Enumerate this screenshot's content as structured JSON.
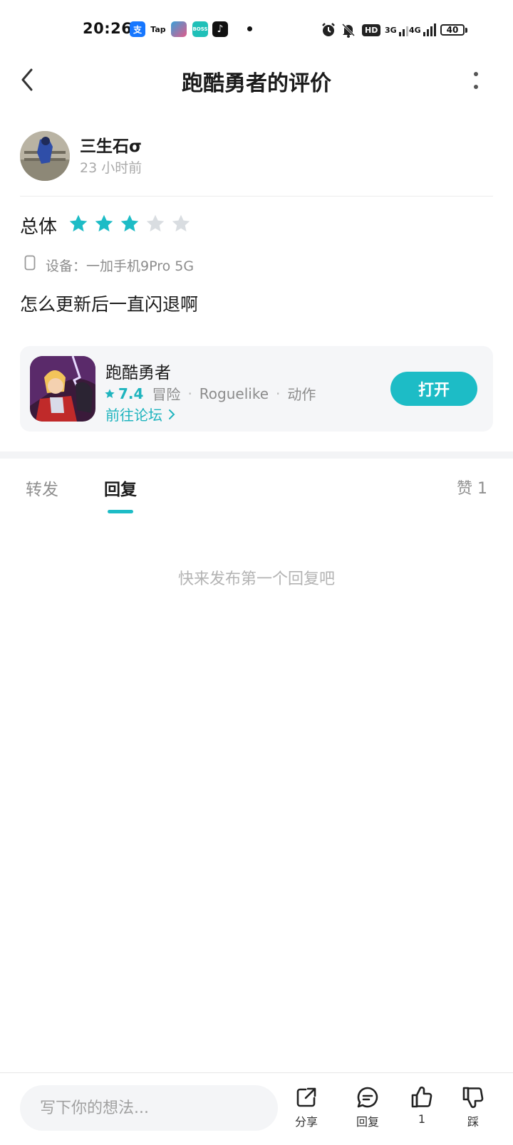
{
  "status_bar": {
    "time": "20:26",
    "apps": [
      {
        "icon": "alipay-icon",
        "glyph": "支",
        "color": "#1677ff"
      },
      {
        "icon": "taptap-icon",
        "glyph": "Tap",
        "color": "#ffffff"
      },
      {
        "icon": "game-app-icon",
        "glyph": "",
        "color": "#3aa0d8"
      },
      {
        "icon": "boss-app-icon",
        "glyph": "BOSS",
        "color": "#1fc0b8"
      },
      {
        "icon": "tiktok-icon",
        "glyph": "♪",
        "color": "#111111"
      }
    ],
    "network_labels": [
      "3G",
      "4G"
    ],
    "hd_label": "HD",
    "battery": "40"
  },
  "header": {
    "title": "跑酷勇者的评价"
  },
  "author": {
    "name": "三生石σ",
    "time": "23 小时前"
  },
  "rating": {
    "label": "总体",
    "score": 3,
    "max": 5,
    "active_color": "#1dbcc6",
    "inactive_color": "#d9dde1"
  },
  "device": {
    "text": "设备：一加手机9Pro 5G"
  },
  "review": {
    "content": "怎么更新后一直闪退啊"
  },
  "game_card": {
    "name": "跑酷勇者",
    "score": "7.4",
    "tags": [
      "冒险",
      "Roguelike",
      "动作"
    ],
    "forum_link": "前往论坛",
    "open_button": "打开"
  },
  "tabs": {
    "repost": "转发",
    "reply": "回复",
    "likes": "赞 1"
  },
  "empty_message": "快来发布第一个回复吧",
  "bottom_bar": {
    "input_placeholder": "写下你的想法...",
    "share": "分享",
    "reply": "回复",
    "like_count": "1",
    "dislike": "踩"
  },
  "colors": {
    "accent": "#1dbcc6"
  }
}
